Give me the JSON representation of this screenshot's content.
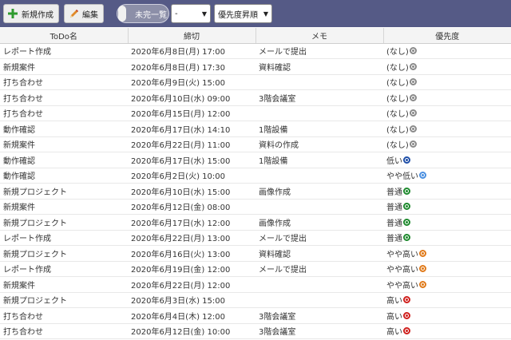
{
  "toolbar": {
    "new_label": "新規作成",
    "edit_label": "編集",
    "toggle_label": "未完一覧",
    "filter_value": "-",
    "sort_value": "優先度昇順"
  },
  "table": {
    "headers": [
      "ToDo名",
      "締切",
      "メモ",
      "優先度"
    ],
    "rows": [
      {
        "name": "レポート作成",
        "deadline": "2020年6月8日(月) 17:00",
        "memo": "メールで提出",
        "priority": "(なし)",
        "level": "none"
      },
      {
        "name": "新規案件",
        "deadline": "2020年6月8日(月) 17:30",
        "memo": "資料確認",
        "priority": "(なし)",
        "level": "none"
      },
      {
        "name": "打ち合わせ",
        "deadline": "2020年6月9日(火) 15:00",
        "memo": "",
        "priority": "(なし)",
        "level": "none"
      },
      {
        "name": "打ち合わせ",
        "deadline": "2020年6月10日(水) 09:00",
        "memo": "3階会議室",
        "priority": "(なし)",
        "level": "none"
      },
      {
        "name": "打ち合わせ",
        "deadline": "2020年6月15日(月) 12:00",
        "memo": "",
        "priority": "(なし)",
        "level": "none"
      },
      {
        "name": "動作確認",
        "deadline": "2020年6月17日(水) 14:10",
        "memo": "1階設備",
        "priority": "(なし)",
        "level": "none"
      },
      {
        "name": "新規案件",
        "deadline": "2020年6月22日(月) 11:00",
        "memo": "資料の作成",
        "priority": "(なし)",
        "level": "none"
      },
      {
        "name": "動作確認",
        "deadline": "2020年6月17日(水) 15:00",
        "memo": "1階設備",
        "priority": "低い",
        "level": "low"
      },
      {
        "name": "動作確認",
        "deadline": "2020年6月2日(火) 10:00",
        "memo": "",
        "priority": "やや低い",
        "level": "slightly-low"
      },
      {
        "name": "新規プロジェクト",
        "deadline": "2020年6月10日(水) 15:00",
        "memo": "画像作成",
        "priority": "普通",
        "level": "normal"
      },
      {
        "name": "新規案件",
        "deadline": "2020年6月12日(金) 08:00",
        "memo": "",
        "priority": "普通",
        "level": "normal"
      },
      {
        "name": "新規プロジェクト",
        "deadline": "2020年6月17日(水) 12:00",
        "memo": "画像作成",
        "priority": "普通",
        "level": "normal"
      },
      {
        "name": "レポート作成",
        "deadline": "2020年6月22日(月) 13:00",
        "memo": "メールで提出",
        "priority": "普通",
        "level": "normal"
      },
      {
        "name": "新規プロジェクト",
        "deadline": "2020年6月16日(火) 13:00",
        "memo": "資料確認",
        "priority": "やや高い",
        "level": "slightly-high"
      },
      {
        "name": "レポート作成",
        "deadline": "2020年6月19日(金) 12:00",
        "memo": "メールで提出",
        "priority": "やや高い",
        "level": "slightly-high"
      },
      {
        "name": "新規案件",
        "deadline": "2020年6月22日(月) 12:00",
        "memo": "",
        "priority": "やや高い",
        "level": "slightly-high"
      },
      {
        "name": "新規プロジェクト",
        "deadline": "2020年6月3日(水) 15:00",
        "memo": "",
        "priority": "高い",
        "level": "high"
      },
      {
        "name": "打ち合わせ",
        "deadline": "2020年6月4日(木) 12:00",
        "memo": "3階会議室",
        "priority": "高い",
        "level": "high"
      },
      {
        "name": "打ち合わせ",
        "deadline": "2020年6月12日(金) 10:00",
        "memo": "3階会議室",
        "priority": "高い",
        "level": "high"
      }
    ]
  },
  "priority_colors": {
    "none": "#8a8a8a",
    "low": "#1f4fa8",
    "slightly-low": "#4a8fe0",
    "normal": "#1e8a2e",
    "slightly-high": "#e07a1a",
    "high": "#d0201d"
  },
  "icons": {
    "new": "plus-icon",
    "edit": "pencil-icon",
    "dropdown": "chevron-down-icon",
    "priority": "priority-circle-icon"
  }
}
